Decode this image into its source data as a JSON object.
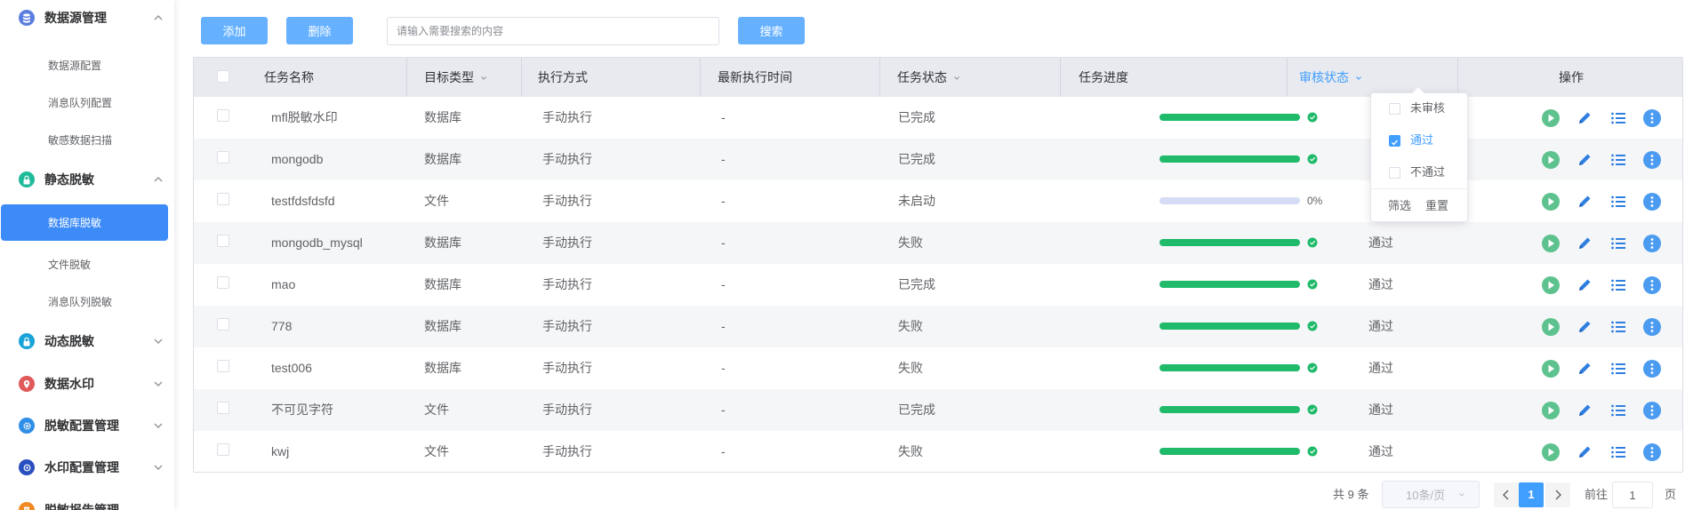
{
  "sidebar": {
    "groups": [
      {
        "label": "数据源管理",
        "icon": "database-icon",
        "color": "#5b7de0",
        "expanded": true
      },
      {
        "label": "静态脱敏",
        "icon": "lock-icon",
        "color": "#1fba9a",
        "expanded": true
      },
      {
        "label": "动态脱敏",
        "icon": "lock-icon",
        "color": "#1aa3d8",
        "expanded": false
      },
      {
        "label": "数据水印",
        "icon": "location-pin-icon",
        "color": "#e05a5a",
        "expanded": false
      },
      {
        "label": "脱敏配置管理",
        "icon": "gear-icon",
        "color": "#2f8ee6",
        "expanded": false
      },
      {
        "label": "水印配置管理",
        "icon": "target-icon",
        "color": "#2a4fbf",
        "expanded": false
      },
      {
        "label": "脱敏报告管理",
        "icon": "report-icon",
        "color": "#f08a24",
        "expanded": false
      }
    ],
    "subitems": [
      {
        "label": "数据源配置",
        "active": false
      },
      {
        "label": "消息队列配置",
        "active": false
      },
      {
        "label": "敏感数据扫描",
        "active": false
      },
      {
        "label": "数据库脱敏",
        "active": true
      },
      {
        "label": "文件脱敏",
        "active": false
      },
      {
        "label": "消息队列脱敏",
        "active": false
      }
    ]
  },
  "toolbar": {
    "add_label": "添加",
    "delete_label": "删除",
    "search_placeholder": "请输入需要搜索的内容",
    "search_value": "",
    "search_label": "搜索"
  },
  "table": {
    "columns": [
      "任务名称",
      "目标类型",
      "执行方式",
      "最新执行时间",
      "任务状态",
      "任务进度",
      "审核状态",
      "操作"
    ],
    "rows": [
      {
        "name": "mfl脱敏水印",
        "target": "数据库",
        "mode": "手动执行",
        "time": "-",
        "status": "已完成",
        "progress": 1.0,
        "progress_label": "",
        "audit": ""
      },
      {
        "name": "mongodb",
        "target": "数据库",
        "mode": "手动执行",
        "time": "-",
        "status": "已完成",
        "progress": 1.0,
        "progress_label": "",
        "audit": ""
      },
      {
        "name": "testfdsfdsfd",
        "target": "文件",
        "mode": "手动执行",
        "time": "-",
        "status": "未启动",
        "progress": 0.0,
        "progress_label": "0%",
        "audit": ""
      },
      {
        "name": "mongodb_mysql",
        "target": "数据库",
        "mode": "手动执行",
        "time": "-",
        "status": "失败",
        "progress": 1.0,
        "progress_label": "",
        "audit": "通过"
      },
      {
        "name": "mao",
        "target": "数据库",
        "mode": "手动执行",
        "time": "-",
        "status": "已完成",
        "progress": 1.0,
        "progress_label": "",
        "audit": "通过"
      },
      {
        "name": "778",
        "target": "数据库",
        "mode": "手动执行",
        "time": "-",
        "status": "失败",
        "progress": 1.0,
        "progress_label": "",
        "audit": "通过"
      },
      {
        "name": "test006",
        "target": "数据库",
        "mode": "手动执行",
        "time": "-",
        "status": "失败",
        "progress": 1.0,
        "progress_label": "",
        "audit": "通过"
      },
      {
        "name": "不可见字符",
        "target": "文件",
        "mode": "手动执行",
        "time": "-",
        "status": "已完成",
        "progress": 1.0,
        "progress_label": "",
        "audit": "通过"
      },
      {
        "name": "kwj",
        "target": "文件",
        "mode": "手动执行",
        "time": "-",
        "status": "失败",
        "progress": 1.0,
        "progress_label": "",
        "audit": "通过"
      }
    ],
    "actions": [
      "play-icon",
      "edit-pencil-icon",
      "list-icon",
      "more-icon"
    ]
  },
  "audit_filter": {
    "options": [
      {
        "label": "未审核",
        "checked": false
      },
      {
        "label": "通过",
        "checked": true
      },
      {
        "label": "不通过",
        "checked": false
      }
    ],
    "confirm_label": "筛选",
    "reset_label": "重置"
  },
  "pagination": {
    "total_label": "共 9 条",
    "page_size_label": "10条/页",
    "current_page": "1",
    "goto_prefix": "前往",
    "goto_value": "1",
    "goto_suffix": "页"
  },
  "colors": {
    "primary": "#409eff",
    "button": "#66b1ff",
    "progress_done": "#1fba6a",
    "progress_track": "#d6dcf5",
    "active_menu": "#3d8bf7"
  }
}
